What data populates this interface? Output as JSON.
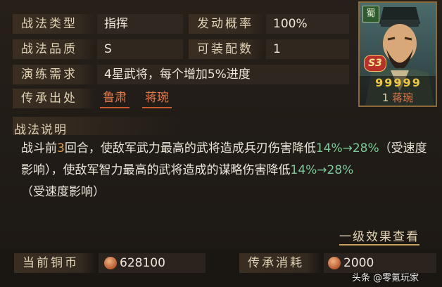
{
  "rows": [
    {
      "label": "战法类型",
      "value": "指挥"
    },
    {
      "label": "发动概率",
      "value": "100%"
    },
    {
      "label": "战法品质",
      "value": "S"
    },
    {
      "label": "可装配数",
      "value": "1"
    },
    {
      "label": "演练需求",
      "value": "4星武将，每个增加5%进度"
    },
    {
      "label": "传承出处",
      "sources": [
        "鲁肃",
        "蒋琬"
      ]
    }
  ],
  "portrait": {
    "faction": "蜀",
    "grade": "S3",
    "cost": "1",
    "name": "蒋琬",
    "stars": "99999"
  },
  "description": {
    "title": "战法说明",
    "p1": "战斗前",
    "n1": "3",
    "p2": "回合，使敌军武力最高的武将造成兵刃伤害降低",
    "r1": "14%→28%",
    "p3": "（受速度影响），使敌军智力最高的武将造成的谋略伤害降低",
    "r2": "14%→28%",
    "p4": "（受速度影响）"
  },
  "link": "一级效果查看",
  "footer": {
    "coins_label": "当前铜币",
    "coins_value": "628100",
    "cost_label": "传承消耗",
    "cost_value": "2000",
    "watermark": "头条 @零氪玩家"
  }
}
